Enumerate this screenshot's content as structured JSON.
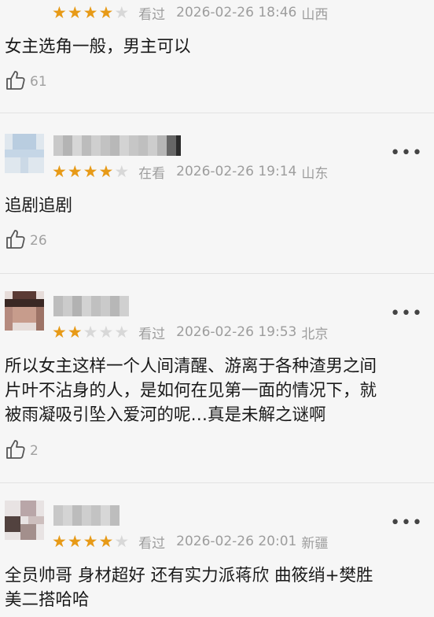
{
  "reviews": [
    {
      "status": "看过",
      "stars": 4,
      "time": "2026-02-26 18:46",
      "location": "山西",
      "content": [
        "女主选角一般，男主可以"
      ],
      "likes": "61"
    },
    {
      "status": "在看",
      "stars": 4,
      "time": "2026-02-26 19:14",
      "location": "山东",
      "content": [
        "追剧追剧"
      ],
      "likes": "26"
    },
    {
      "status": "看过",
      "stars": 2,
      "time": "2026-02-26 19:53",
      "location": "北京",
      "content": [
        "所以女主这样一个人间清醒、游离于各种渣男之间",
        "片叶不沾身的人，是如何在见第一面的情况下，就",
        "被雨凝吸引坠入爱河的呢…真是未解之谜啊"
      ],
      "likes": "2"
    },
    {
      "status": "看过",
      "stars": 4,
      "time": "2026-02-26 20:01",
      "location": "新疆",
      "content": [
        "全员帅哥 身材超好 还有实力派蒋欣 曲筱绡+樊胜",
        "美二搭哈哈"
      ],
      "likes": ""
    }
  ],
  "icons": {
    "star": "star-icon",
    "like": "thumbs-up-icon",
    "more": "more-dots-icon"
  },
  "colors": {
    "star_on": "#e79a17",
    "star_off": "#d8d8d8",
    "meta_text": "#9d9d9d"
  }
}
